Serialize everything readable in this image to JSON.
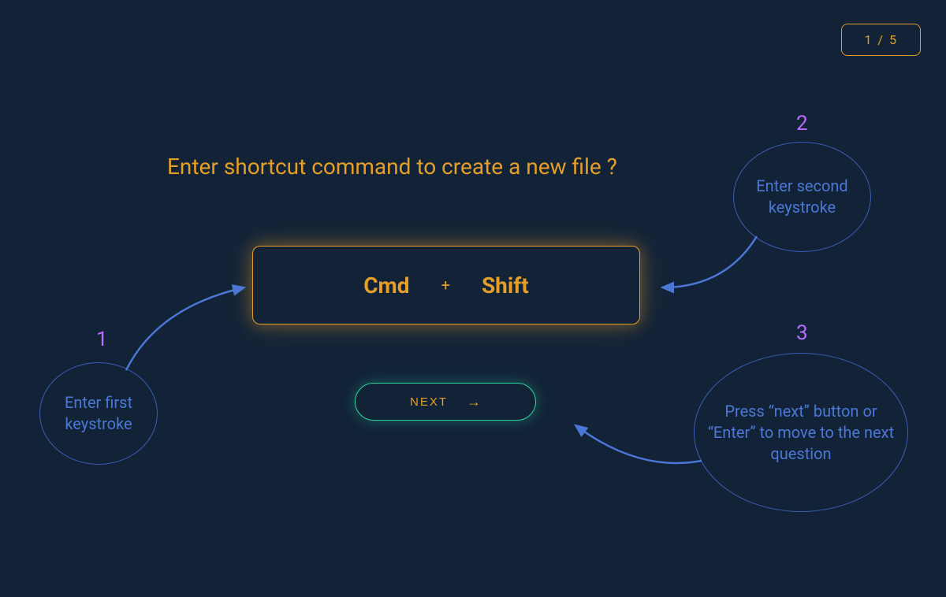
{
  "progress": "1 / 5",
  "question": "Enter shortcut command to create a new file ?",
  "input": {
    "key1": "Cmd",
    "plus": "+",
    "key2": "Shift"
  },
  "nextButton": "NEXT",
  "callouts": {
    "1": {
      "num": "1",
      "text": "Enter first keystroke"
    },
    "2": {
      "num": "2",
      "text": "Enter second keystroke"
    },
    "3": {
      "num": "3",
      "text": "Press “next” button or “Enter” to move to the next question"
    }
  }
}
